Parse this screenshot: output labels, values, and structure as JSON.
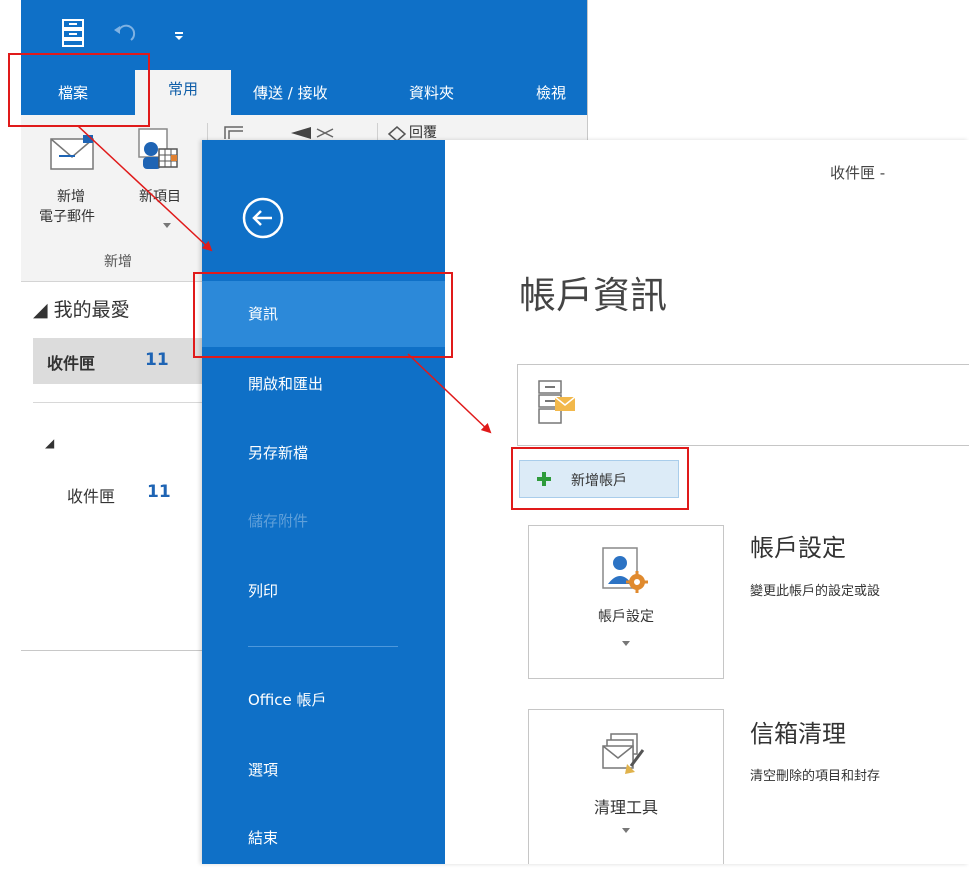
{
  "ribbon_tabs": [
    {
      "label": "檔案"
    },
    {
      "label": "常用"
    },
    {
      "label": "傳送 / 接收"
    },
    {
      "label": "資料夾"
    },
    {
      "label": "檢視"
    }
  ],
  "ribbon": {
    "new_email_line1": "新增",
    "new_email_line2": "電子郵件",
    "new_items": "新項目",
    "group_label": "新增",
    "reply_label": "回覆"
  },
  "nav": {
    "favorites": "◢ 我的最愛",
    "inbox_label": "收件匣",
    "inbox_count": "11",
    "account_marker": "◢",
    "inbox2_label": "收件匣",
    "inbox2_count": "11"
  },
  "backstage": {
    "menu": [
      {
        "label": "資訊"
      },
      {
        "label": "開啟和匯出"
      },
      {
        "label": "另存新檔"
      },
      {
        "label": "儲存附件"
      },
      {
        "label": "列印"
      },
      {
        "label": "Office 帳戶"
      },
      {
        "label": "選項"
      },
      {
        "label": "結束"
      }
    ],
    "window_title": "收件匣 -",
    "page_title": "帳戶資訊",
    "add_account_label": "新增帳戶",
    "account_settings": {
      "button_label": "帳戶設定",
      "heading": "帳戶設定",
      "description": "變更此帳戶的設定或設"
    },
    "mailbox_cleanup": {
      "button_label": "清理工具",
      "heading": "信箱清理",
      "description": "清空刪除的項目和封存"
    }
  },
  "colors": {
    "outlook_blue": "#0f70c7",
    "selected_blue": "#2c89d9",
    "annotation_red": "#e01a1a",
    "count_blue": "#1e64b4"
  }
}
